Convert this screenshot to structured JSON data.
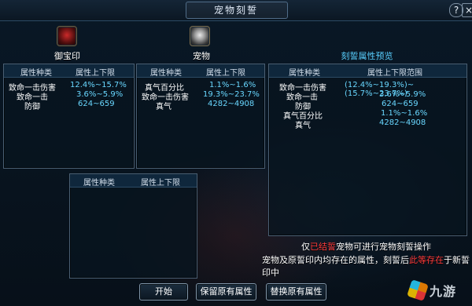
{
  "window": {
    "title": "宠物刻誓",
    "help_glyph": "?",
    "close_glyph": "×"
  },
  "icons": {
    "left_item": "seal-icon",
    "right_item": "pet-icon"
  },
  "labels": {
    "left_item": "御宝印",
    "right_item": "宠物",
    "preview_title": "刻誓属性预览"
  },
  "panels": {
    "seal": {
      "headers": [
        "属性种类",
        "属性上下限"
      ],
      "rows": [
        {
          "type": "致命一击伤害",
          "range": "12.4%~15.7%"
        },
        {
          "type": "致命一击",
          "range": "3.6%~5.9%"
        },
        {
          "type": "防御",
          "range": "624~659"
        }
      ]
    },
    "pet": {
      "headers": [
        "属性种类",
        "属性上下限"
      ],
      "rows": [
        {
          "type": "真气百分比",
          "range": "1.1%~1.6%"
        },
        {
          "type": "致命一击伤害",
          "range": "19.3%~23.7%"
        },
        {
          "type": "真气",
          "range": "4282~4908"
        }
      ]
    },
    "preview": {
      "headers": [
        "属性种类",
        "属性上下限范围"
      ],
      "rows": [
        {
          "type": "致命一击伤害",
          "range": "(12.4%~19.3%)~(15.7%~23.7%)"
        },
        {
          "type": "致命一击",
          "range": "3.6%~5.9%"
        },
        {
          "type": "防御",
          "range": "624~659"
        },
        {
          "type": "真气百分比",
          "range": "1.1%~1.6%"
        },
        {
          "type": "真气",
          "range": "4282~4908"
        }
      ]
    },
    "result": {
      "headers": [
        "属性种类",
        "属性上下限"
      ],
      "rows": []
    }
  },
  "messages": {
    "line1_prefix": "仅",
    "line1_highlight": "已结誓",
    "line1_suffix": "宠物可进行宠物刻誓操作",
    "line2_prefix": "宠物及原誓印内均存在的属性，刻誓后",
    "line2_highlight": "此等存在",
    "line2_suffix": "于新誓印中"
  },
  "buttons": {
    "start": "开始",
    "keep": "保留原有属性",
    "replace": "替换原有属性"
  },
  "watermark": {
    "text": "九游"
  },
  "colors": {
    "value": "#69d7ff",
    "red": "#ff3b3b",
    "border": "#4a5f73"
  }
}
